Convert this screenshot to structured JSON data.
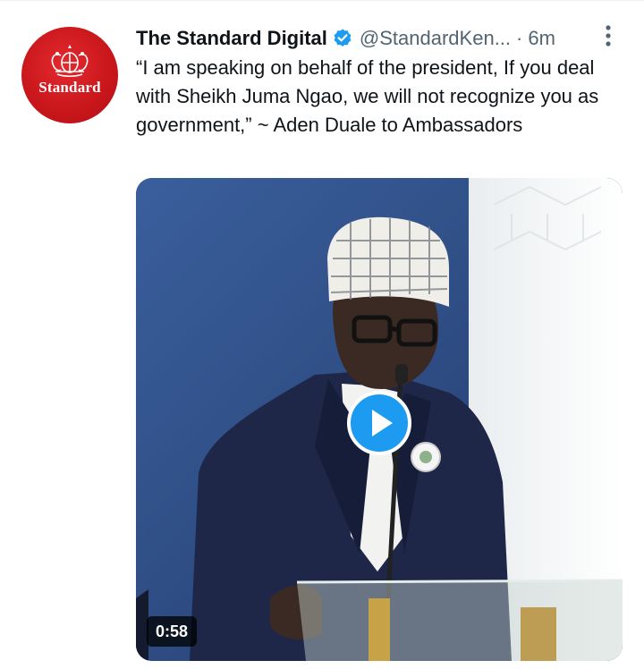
{
  "tweet": {
    "avatar_text": "Standard",
    "display_name": "The Standard Digital",
    "handle": "@StandardKen...",
    "separator": "·",
    "time": "6m",
    "text": "“I am speaking on behalf of the president, If you deal with Sheikh Juma Ngao, we will not recognize you as government,” ~ Aden Duale to Ambassadors",
    "media": {
      "duration": "0:58"
    }
  },
  "colors": {
    "brand_red": "#c8161b",
    "verified_blue": "#1d9bf0",
    "secondary_text": "#536471"
  },
  "icons": {
    "verified": "verified-badge-icon",
    "more": "more-vertical-icon",
    "play": "play-icon"
  }
}
